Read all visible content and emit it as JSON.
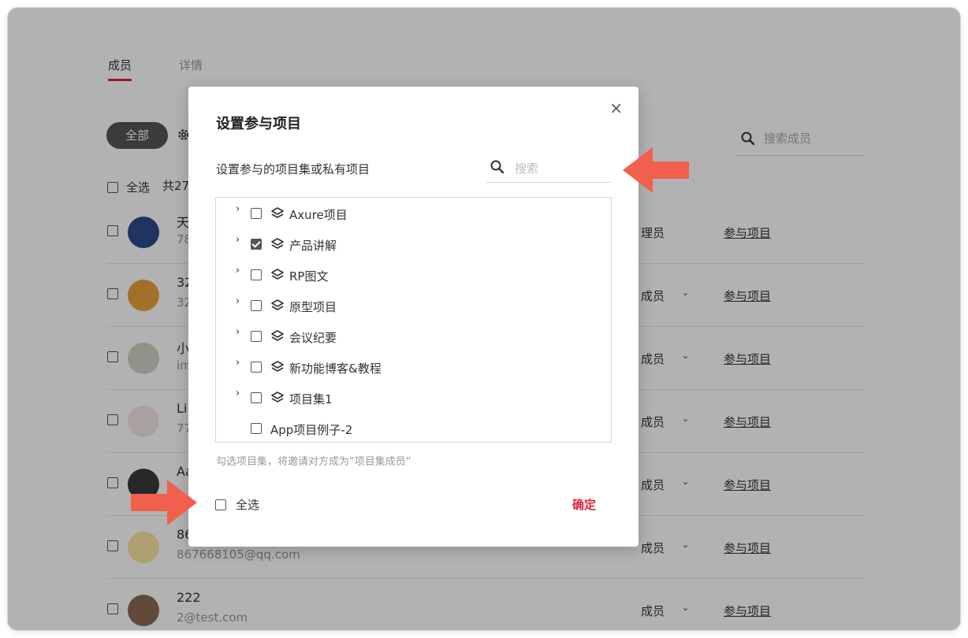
{
  "tabs": {
    "members": "成员",
    "details": "详情"
  },
  "filter": {
    "all_label": "全部",
    "gear_icon": "gear-icon"
  },
  "member_search": {
    "placeholder": "搜索成员"
  },
  "list": {
    "select_all": "全选",
    "count_prefix": "共27"
  },
  "members": [
    {
      "name": "天",
      "email": "78",
      "role": "理员",
      "has_caret": false,
      "join": "参与项目"
    },
    {
      "name": "32",
      "email": "32",
      "role": "成员",
      "has_caret": true,
      "join": "参与项目"
    },
    {
      "name": "小",
      "email": "im",
      "role": "成员",
      "has_caret": true,
      "join": "参与项目"
    },
    {
      "name": "Li",
      "email": "77",
      "role": "成员",
      "has_caret": true,
      "join": "参与项目"
    },
    {
      "name": "Aa",
      "email": "",
      "role": "成员",
      "has_caret": true,
      "join": "参与项目"
    },
    {
      "name": "86",
      "email": "867668105@qq.com",
      "role": "成员",
      "has_caret": true,
      "join": "参与项目"
    },
    {
      "name": "222",
      "email": "2@test.com",
      "role": "成员",
      "has_caret": true,
      "join": "参与项目"
    }
  ],
  "modal": {
    "title": "设置参与项目",
    "close": "×",
    "subtitle": "设置参与的项目集或私有项目",
    "search_placeholder": "搜索",
    "items": [
      {
        "label": "Axure项目",
        "checked": false,
        "is_set": true
      },
      {
        "label": "产品讲解",
        "checked": true,
        "is_set": true
      },
      {
        "label": "RP图文",
        "checked": false,
        "is_set": true
      },
      {
        "label": "原型项目",
        "checked": false,
        "is_set": true
      },
      {
        "label": "会议纪要",
        "checked": false,
        "is_set": true
      },
      {
        "label": "新功能博客&教程",
        "checked": false,
        "is_set": true
      },
      {
        "label": "项目集1",
        "checked": false,
        "is_set": true
      },
      {
        "label": "App项目例子-2",
        "checked": false,
        "is_set": false
      }
    ],
    "hint": "勾选项目集，将邀请对方成为“项目集成员”",
    "select_all": "全选",
    "confirm": "确定"
  },
  "colors": {
    "accent": "#e0223a",
    "callout": "#f0604d"
  }
}
